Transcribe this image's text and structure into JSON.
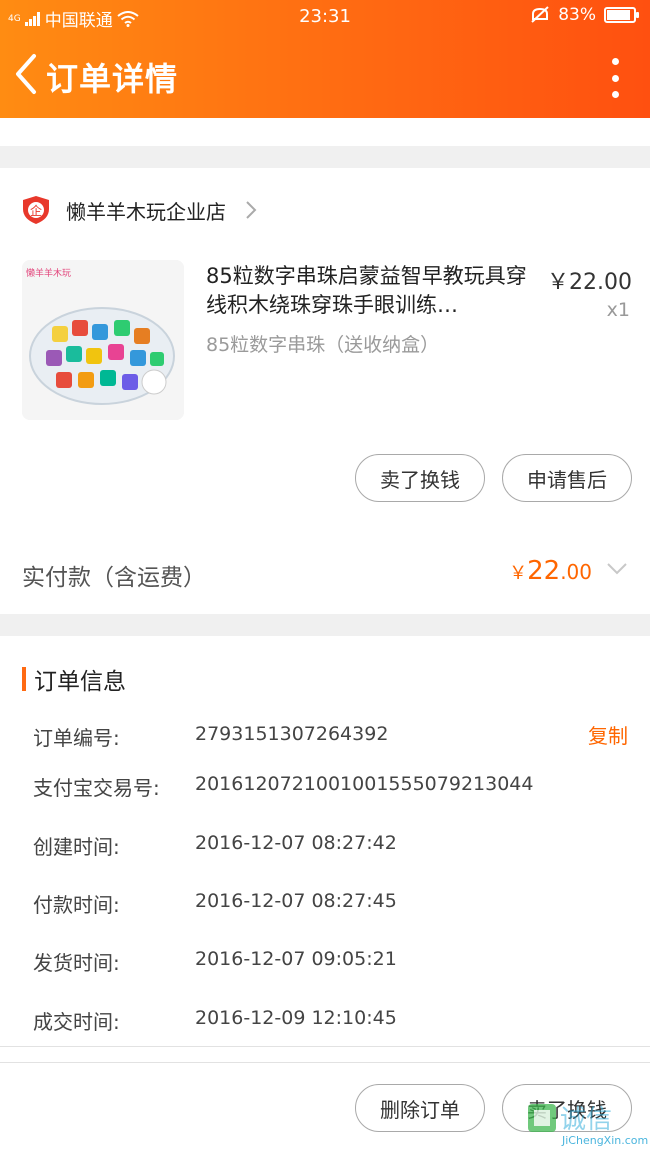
{
  "status_bar": {
    "network": "4G",
    "carrier": "中国联通",
    "time": "23:31",
    "battery": "83%"
  },
  "header": {
    "title": "订单详情",
    "back_icon": "chevron-left-icon",
    "more_icon": "more-vertical-icon"
  },
  "shop": {
    "badge_icon": "enterprise-shield-icon",
    "badge_text": "企",
    "name": "懒羊羊木玩企业店"
  },
  "product": {
    "title": "85粒数字串珠启蒙益智早教玩具穿线积木绕珠穿珠手眼训练…",
    "sku": "85粒数字串珠（送收纳盒）",
    "price": "￥22.00",
    "quantity": "x1",
    "image_brand": "懒羊羊木玩"
  },
  "actions": {
    "sell_label": "卖了换钱",
    "after_sale_label": "申请售后"
  },
  "payment": {
    "label": "实付款（含运费）",
    "currency": "￥",
    "amount_int": "22",
    "amount_dec": ".00"
  },
  "order_info": {
    "section_title": "订单信息",
    "copy_label": "复制",
    "rows": [
      {
        "label": "订单编号:",
        "value": "2793151307264392"
      },
      {
        "label": "支付宝交易号:",
        "value": "2016120721001001555079213044"
      },
      {
        "label": "创建时间:",
        "value": "2016-12-07 08:27:42"
      },
      {
        "label": "付款时间:",
        "value": "2016-12-07 08:27:45"
      },
      {
        "label": "发货时间:",
        "value": "2016-12-07 09:05:21"
      },
      {
        "label": "成交时间:",
        "value": "2016-12-09 12:10:45"
      }
    ]
  },
  "footer": {
    "delete_label": "删除订单",
    "sell_label": "卖了换钱"
  },
  "watermark": {
    "text": "JiChengXin.com",
    "chars": "诚信"
  },
  "colors": {
    "accent": "#ff6a12",
    "price": "#ff6600"
  }
}
